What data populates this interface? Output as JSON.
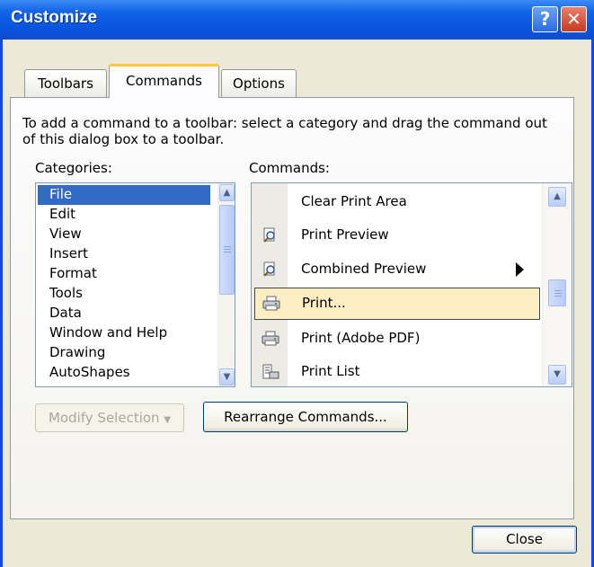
{
  "window": {
    "title": "Customize"
  },
  "tabs": [
    {
      "label": "Toolbars",
      "active": false
    },
    {
      "label": "Commands",
      "active": true
    },
    {
      "label": "Options",
      "active": false
    }
  ],
  "description": "To add a command to a toolbar: select a category and drag the command out of this dialog box to a toolbar.",
  "categories": {
    "label": "Categories:",
    "selected": "File",
    "items": [
      "File",
      "Edit",
      "View",
      "Insert",
      "Format",
      "Tools",
      "Data",
      "Window and Help",
      "Drawing",
      "AutoShapes"
    ]
  },
  "commands": {
    "label": "Commands:",
    "selected": "Print...",
    "items": [
      {
        "label": "Clear Print Area",
        "icon": "none",
        "submenu": false
      },
      {
        "label": "Print Preview",
        "icon": "print-preview-icon",
        "submenu": false
      },
      {
        "label": "Combined Preview",
        "icon": "combined-preview-icon",
        "submenu": true
      },
      {
        "label": "Print...",
        "icon": "printer-icon",
        "submenu": false
      },
      {
        "label": "Print (Adobe PDF)",
        "icon": "printer-icon",
        "submenu": false
      },
      {
        "label": "Print List",
        "icon": "print-list-icon",
        "submenu": false
      }
    ]
  },
  "buttons": {
    "modify_selection": "Modify Selection",
    "rearrange_commands": "Rearrange Commands...",
    "close": "Close"
  },
  "colors": {
    "title_bar": "#0a55de",
    "selection": "#316ac5",
    "dialog_bg": "#ece9d8"
  }
}
